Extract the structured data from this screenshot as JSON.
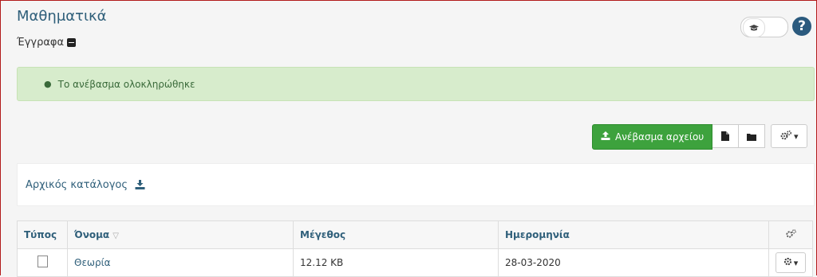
{
  "header": {
    "course_title": "Μαθηματικά",
    "section_title": "Έγγραφα"
  },
  "alert": {
    "message": "Το ανέβασμα ολοκληρώθηκε",
    "color": "#d7eccc"
  },
  "toolbar": {
    "upload_label": "Ανέβασμα αρχείου",
    "upload_color": "#3da23d"
  },
  "breadcrumb": {
    "root_label": "Αρχικός κατάλογος"
  },
  "table": {
    "headers": {
      "type": "Τύπος",
      "name": "Όνομα",
      "size": "Μέγεθος",
      "date": "Ημερομηνία"
    },
    "rows": [
      {
        "name": "Θεωρία",
        "size": "12.12 KB",
        "date": "28-03-2020",
        "icon": "word-document-icon"
      }
    ]
  },
  "colors": {
    "link": "#2f5f7a",
    "help": "#2b5a7e",
    "frame_border": "#b21b1b"
  }
}
